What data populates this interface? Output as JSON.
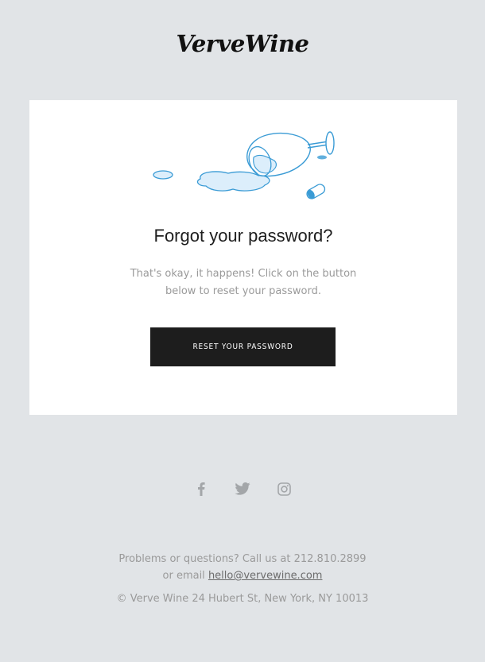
{
  "brand": {
    "logo_text": "VerveWine"
  },
  "card": {
    "illustration": "spilled-wine-glass",
    "title": "Forgot your password?",
    "body_line1": "That's okay, it happens! Click on the button",
    "body_line2": "below to reset your password.",
    "button_label": "RESET YOUR PASSWORD"
  },
  "social": [
    {
      "name": "facebook-icon"
    },
    {
      "name": "twitter-icon"
    },
    {
      "name": "instagram-icon"
    }
  ],
  "footer": {
    "contact_prefix": "Problems or questions? Call us at 212.810.2899",
    "email_prefix": "or email ",
    "email": "hello@vervewine.com",
    "address": "© Verve Wine 24 Hubert St, New York, NY 10013"
  },
  "colors": {
    "background": "#e1e4e7",
    "card": "#ffffff",
    "button": "#1d1d1d",
    "illustration_blue": "#3a9bd5"
  }
}
